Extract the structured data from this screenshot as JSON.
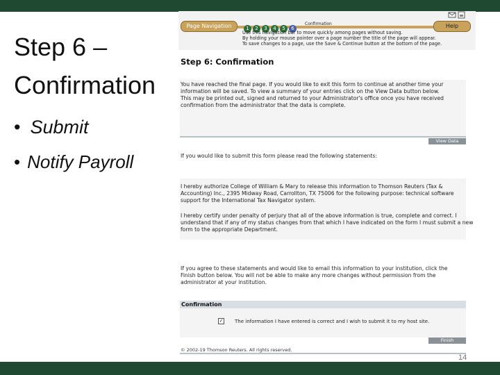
{
  "slide": {
    "title_line1": "Step 6 –",
    "title_line2": "Confirmation",
    "bullet_glyph": "•",
    "bullets": [
      "Submit",
      "Notify Payroll"
    ],
    "page_number": "14"
  },
  "screenshot": {
    "toolbar_icons": [
      "envelope-icon",
      "print-icon"
    ],
    "page_nav_tab": "Page Navigation",
    "nav_steps": [
      "1",
      "2",
      "3",
      "4",
      "5",
      "6"
    ],
    "current_step_label": "Confirmation",
    "help_button": "Help",
    "nav_hint_lines": [
      "Use this navigation bar to move quickly among pages without saving.",
      "By holding your mouse pointer over a page number the title of the page will appear.",
      "To save changes to a page, use the Save & Continue button at the bottom of the page."
    ],
    "step_heading": "Step 6: Confirmation",
    "intro_lines": [
      "You have reached the final page. If you would like to exit this form to continue at another time your",
      "information will be saved. To view a summary of your entries click on the View Data button below.",
      "This may be printed out, signed and returned to your Administrator's office once you have received",
      "confirmation from the administrator that the data is complete."
    ],
    "view_data_button": "View Data",
    "submit_prompt": "If you would like to submit this form please read the following statements:",
    "authorize_lines": [
      "I hereby authorize College of William & Mary to release this information to Thomson Reuters (Tax &",
      "Accounting) Inc., 2395 Midway Road, Carrollton, TX 75006 for the following purpose: technical software",
      "support for the International Tax Navigator system."
    ],
    "certify_lines": [
      "I hereby certify under penalty of perjury that all of the above information is true, complete and correct. I",
      "understand that if any of my status changes from that which I have indicated on the form I must submit a new",
      "form to the appropriate Department."
    ],
    "agree_lines": [
      "If you agree to these statements and would like to email this information to your institution, click the",
      "Finish button below. You will not be able to make any more changes without permission from the",
      "administrator at your institution."
    ],
    "confirmation_header": "Confirmation",
    "checkbox_mark": "✓",
    "confirmation_text": "The information I have entered is correct and I wish to submit it to my host site.",
    "finish_button": "Finish",
    "copyright": "© 2002-19 Thomson Reuters. All rights reserved."
  }
}
